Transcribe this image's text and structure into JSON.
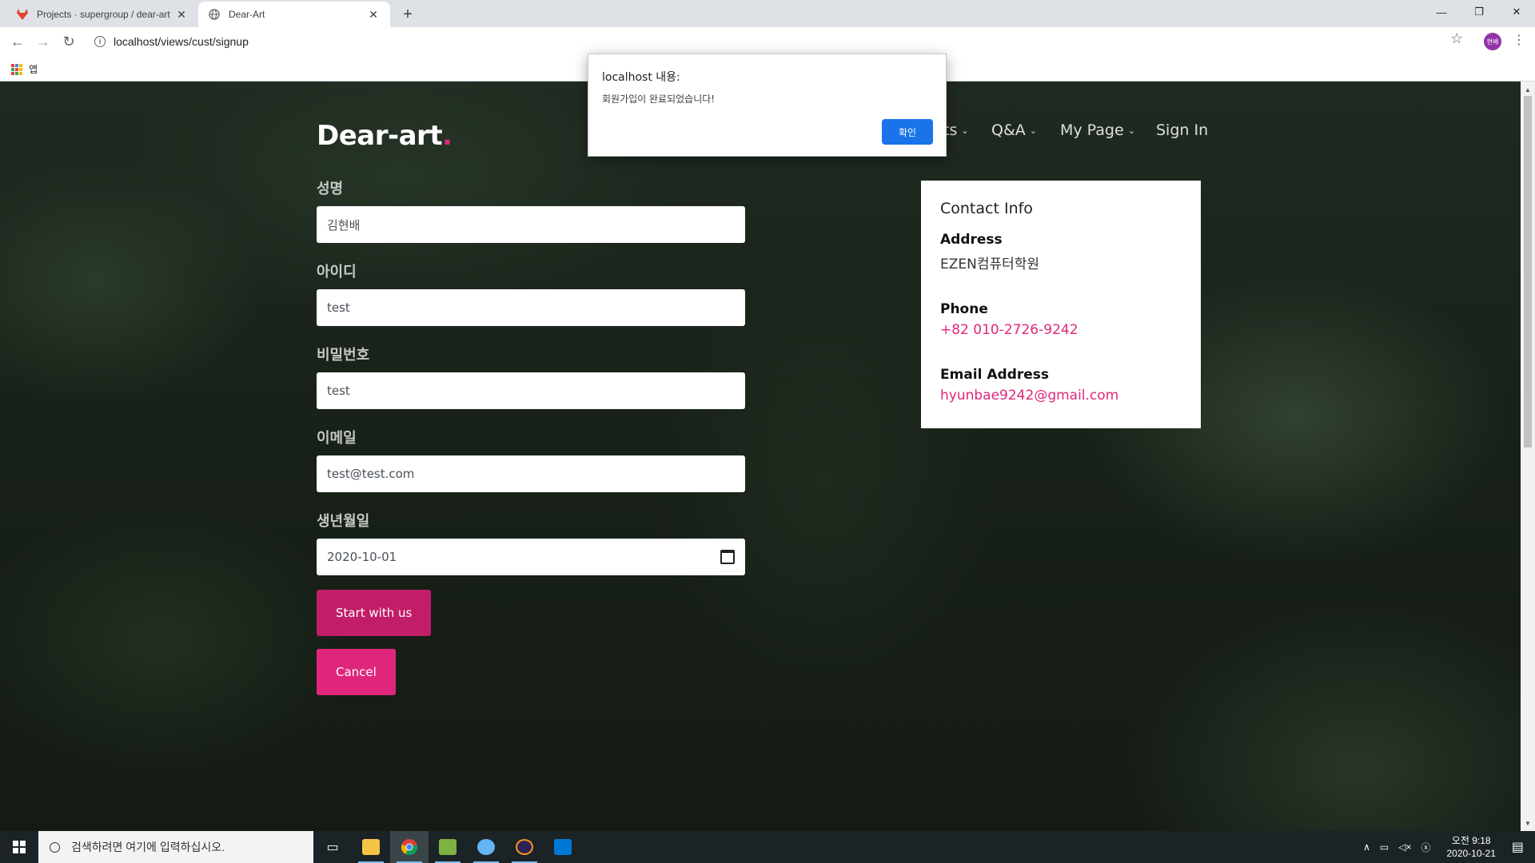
{
  "browser": {
    "tabs": [
      {
        "title": "Projects · supergroup / dear-art",
        "active": false
      },
      {
        "title": "Dear-Art",
        "active": true
      }
    ],
    "url": "localhost/views/cust/signup",
    "profile_initials": "현배",
    "bookmarks": {
      "apps_label": "앱"
    }
  },
  "site": {
    "brand": "Dear-art",
    "brand_dot": ".",
    "nav": [
      {
        "label": "ts"
      },
      {
        "label": "Q&A"
      },
      {
        "label": "My Page"
      },
      {
        "label": "Sign In"
      }
    ]
  },
  "form": {
    "fields": [
      {
        "label": "성명",
        "value": "김현배"
      },
      {
        "label": "아이디",
        "value": "test"
      },
      {
        "label": "비밀번호",
        "value": "test"
      },
      {
        "label": "이메일",
        "value": "test@test.com"
      },
      {
        "label": "생년월일",
        "value": "2020-10-01"
      }
    ],
    "submit_label": "Start with us",
    "cancel_label": "Cancel"
  },
  "contact": {
    "title": "Contact Info",
    "address_label": "Address",
    "address": "EZEN컴퓨터학원",
    "phone_label": "Phone",
    "phone": "+82 010-2726-9242",
    "email_label": "Email Address",
    "email": "hyunbae9242@gmail.com"
  },
  "alert": {
    "title": "localhost 내용:",
    "message": "회원가입이 완료되었습니다!",
    "ok_label": "확인"
  },
  "taskbar": {
    "search_placeholder": "검색하려면 여기에 입력하십시오.",
    "time": "오전 9:18",
    "date": "2020-10-21"
  },
  "colors": {
    "accent": "#e0267b",
    "accent_dark": "#c21d69",
    "dialog_button": "#1a73e8"
  }
}
